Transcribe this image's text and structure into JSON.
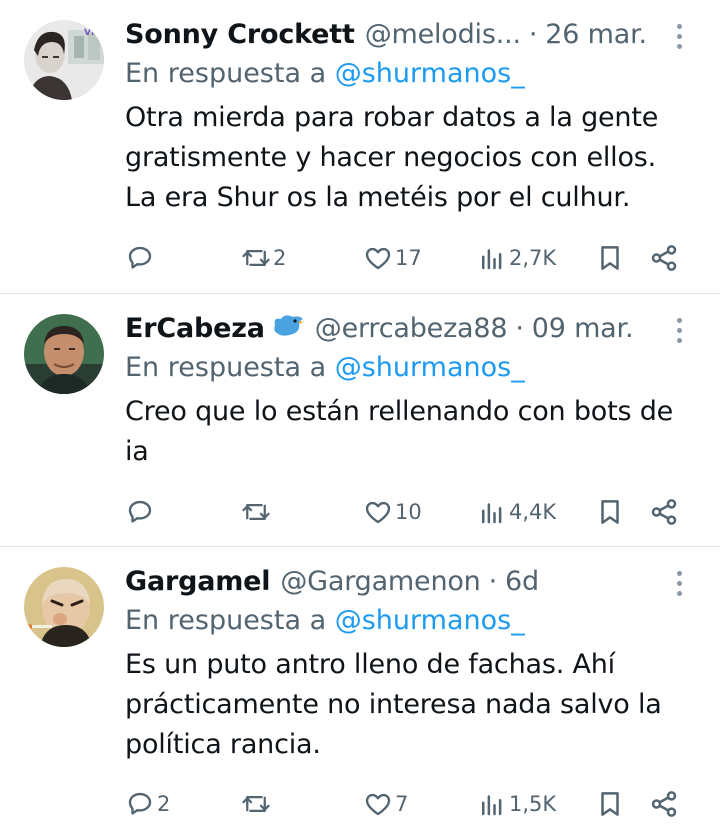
{
  "tweets": [
    {
      "name": "Sonny Crockett",
      "handle": "@melodis...",
      "separator": "·",
      "date": "26 mar.",
      "reply_prefix": "En respuesta a",
      "reply_mention": "@shurmanos_",
      "text_lines": [
        "Otra mierda para robar datos a la gente",
        "gratismente y hacer negocios con ellos.",
        "La era Shur os la metéis por el culhur."
      ],
      "replies": "",
      "retweets": "2",
      "likes": "17",
      "views": "2,7K"
    },
    {
      "name": "ErCabeza",
      "verified_icon": "bird-emoji-icon",
      "handle": "@errcabeza88",
      "separator": "·",
      "date": "09 mar.",
      "reply_prefix": "En respuesta a",
      "reply_mention": "@shurmanos_",
      "text_lines": [
        "Creo que lo están rellenando con bots de",
        "ia"
      ],
      "replies": "",
      "retweets": "",
      "likes": "10",
      "views": "4,4K"
    },
    {
      "name": "Gargamel",
      "handle": "@Gargamenon",
      "separator": "·",
      "date": "6d",
      "reply_prefix": "En respuesta a",
      "reply_mention": "@shurmanos_",
      "text_lines": [
        "Es un puto antro lleno de fachas. Ahí",
        "prácticamente no interesa nada salvo la",
        "política rancia."
      ],
      "replies": "2",
      "retweets": "",
      "likes": "7",
      "views": "1,5K"
    }
  ],
  "colors": {
    "mention": "#1d9bf0",
    "secondary": "#536471",
    "text": "#0f1419",
    "divider": "#e3e6e9"
  }
}
